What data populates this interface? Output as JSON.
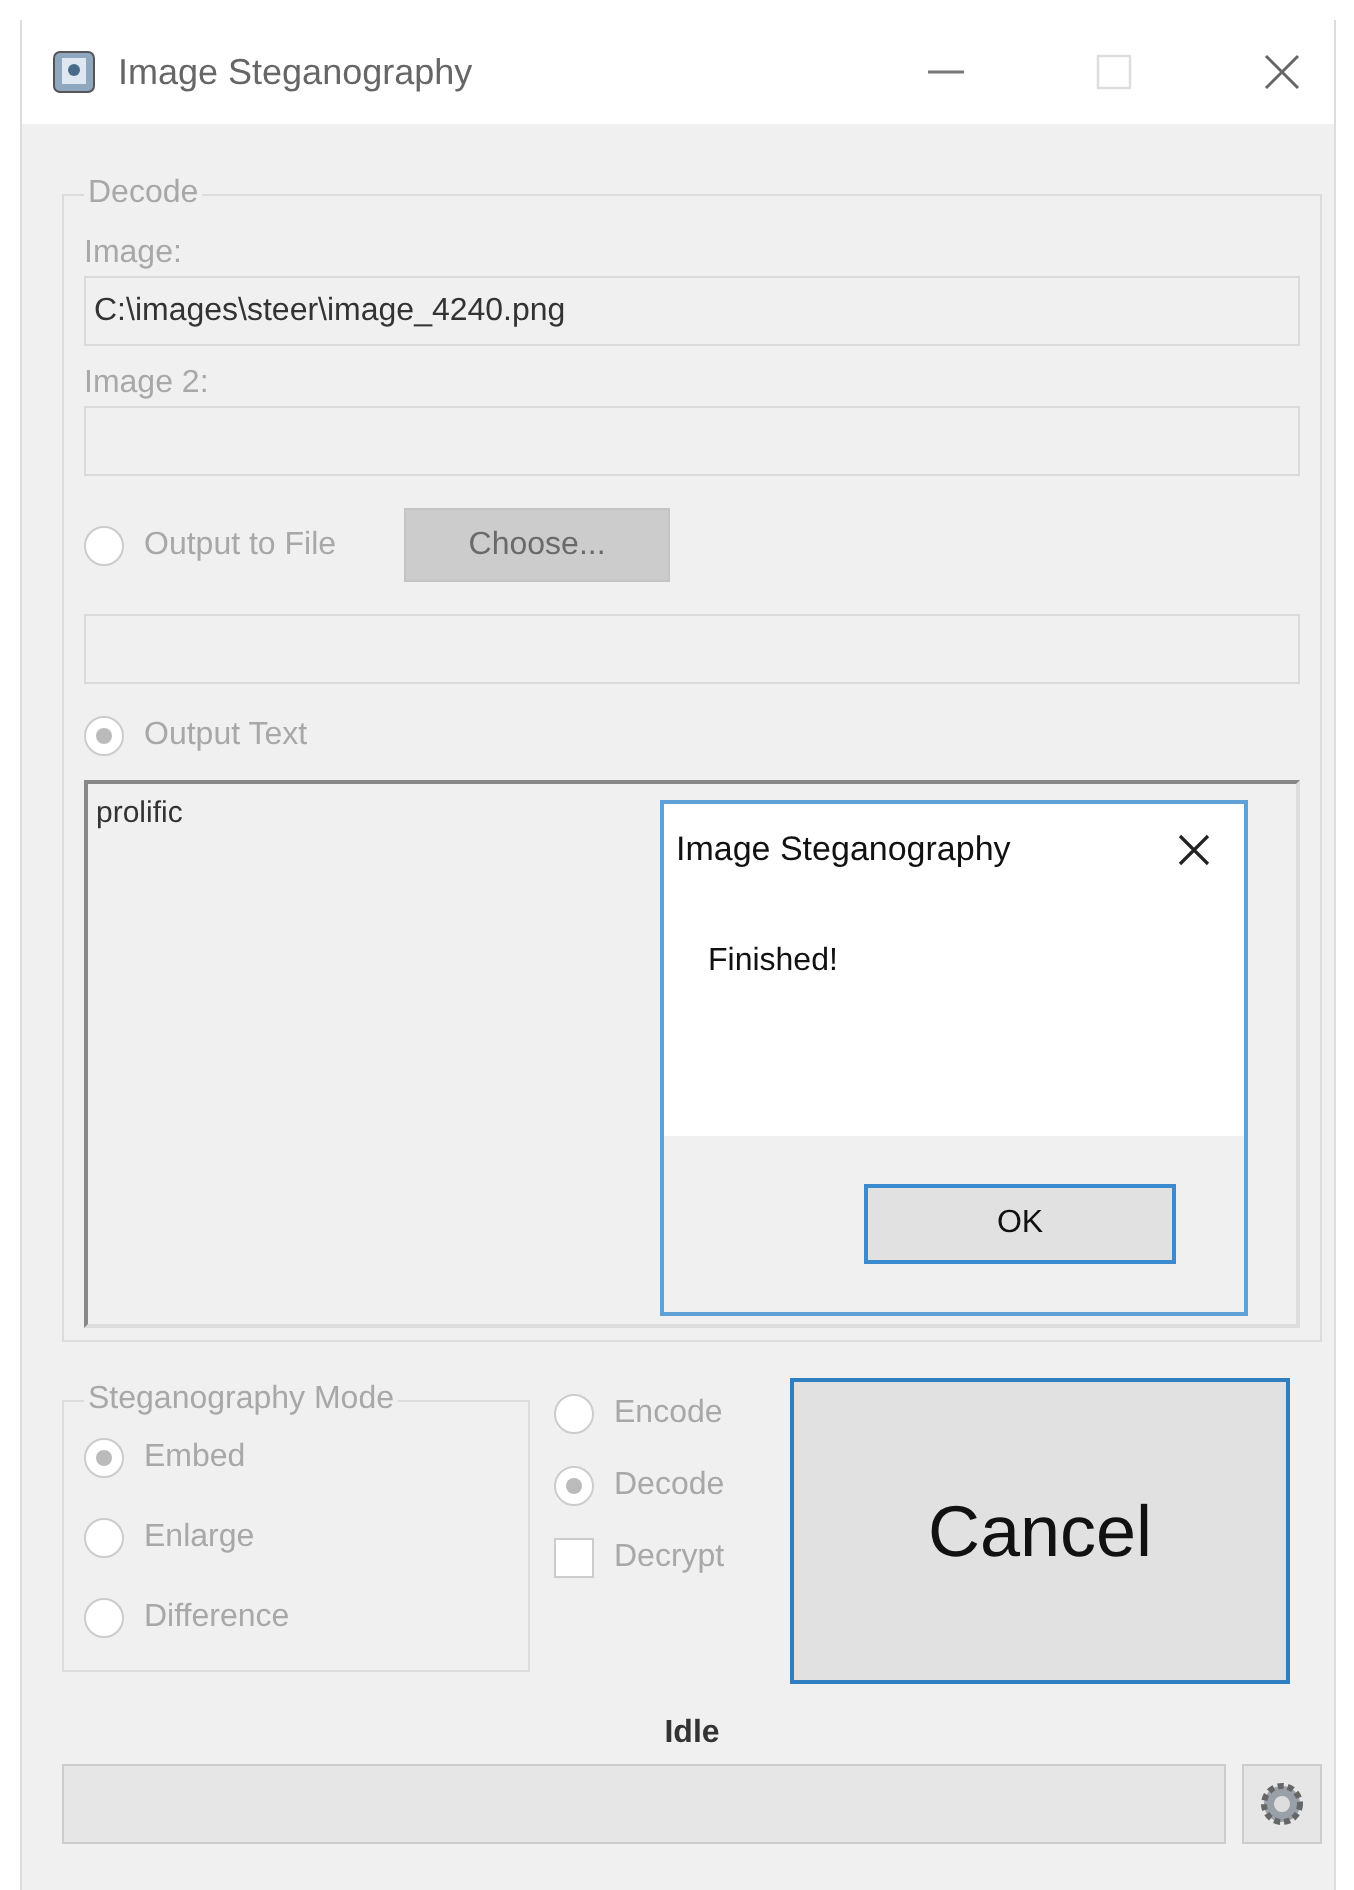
{
  "window": {
    "title": "Image Steganography"
  },
  "decode_group": {
    "legend": "Decode",
    "disabled": true,
    "image_label": "Image:",
    "image_path": "C:\\images\\steer\\image_4240.png",
    "image2_label": "Image 2:",
    "output_to_file": {
      "label": "Output to File",
      "selected": false
    },
    "choose_button": {
      "label": "Choose..."
    },
    "output_text": {
      "label": "Output Text",
      "selected": true
    },
    "text_value": "prolific"
  },
  "dialog": {
    "title": "Image Steganography",
    "message": "Finished!",
    "ok_button": "OK"
  },
  "mode_group": {
    "legend": "Steganography Mode",
    "options": [
      {
        "label": "Embed",
        "selected": true
      },
      {
        "label": "Enlarge",
        "selected": false
      },
      {
        "label": "Difference",
        "selected": false
      }
    ]
  },
  "direction": [
    {
      "label": "Encode",
      "selected": false
    },
    {
      "label": "Decode",
      "selected": true
    }
  ],
  "decrypt": {
    "label": "Decrypt",
    "checked": false
  },
  "cancel_button": "Cancel",
  "status": "Idle",
  "progress": {
    "level": 0
  }
}
